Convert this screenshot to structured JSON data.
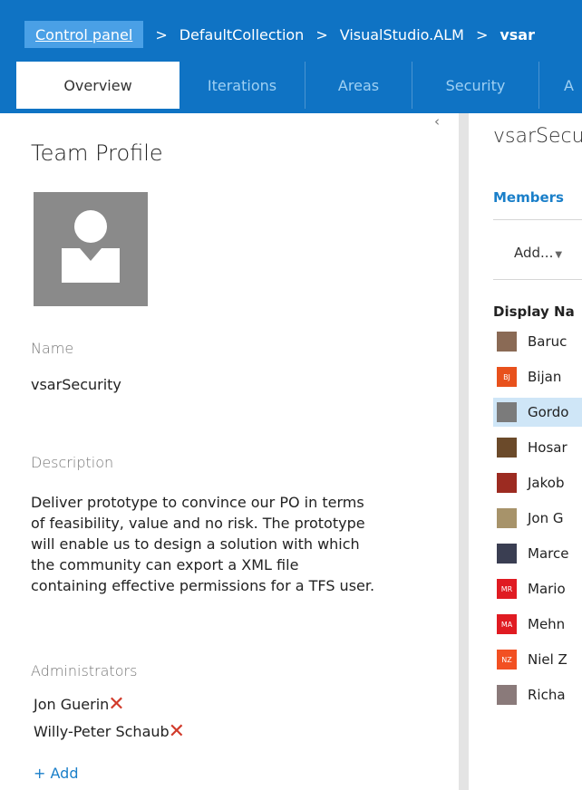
{
  "breadcrumb": {
    "home": "Control panel",
    "separator": ">",
    "collection": "DefaultCollection",
    "project": "VisualStudio.ALM",
    "current": "vsar"
  },
  "tabs": [
    {
      "label": "Overview",
      "active": true
    },
    {
      "label": "Iterations",
      "active": false
    },
    {
      "label": "Areas",
      "active": false
    },
    {
      "label": "Security",
      "active": false
    },
    {
      "label": "A",
      "active": false
    }
  ],
  "left": {
    "collapse_glyph": "‹",
    "title": "Team Profile",
    "avatar_icon": "default-team-avatar-icon",
    "name_label": "Name",
    "name_value": "vsarSecurity",
    "description_label": "Description",
    "description_value": "Deliver prototype to convince our PO in terms of feasibility, value and no risk. The prototype will enable us to design a solution with which the community can export a XML file containing effective permissions for a TFS user.",
    "administrators_label": "Administrators",
    "administrators": [
      {
        "name": "Jon Guerin",
        "remove_icon": "✕"
      },
      {
        "name": "Willy-Peter Schaub",
        "remove_icon": "✕"
      }
    ],
    "add_admin": "+ Add"
  },
  "right": {
    "team_name": "vsarSecu",
    "members_tab": "Members",
    "add_menu": "Add...",
    "add_caret": "▼",
    "column_header": "Display Na",
    "members": [
      {
        "name": "Baruc",
        "avatar": "photo",
        "color": "#8a6a55",
        "initials": ""
      },
      {
        "name": "Bijan",
        "avatar": "initials",
        "color": "#e8511c",
        "initials": "BJ"
      },
      {
        "name": "Gordo",
        "avatar": "photo",
        "color": "#7b7b7b",
        "initials": "",
        "selected": true
      },
      {
        "name": "Hosar",
        "avatar": "photo",
        "color": "#6b4a2a",
        "initials": ""
      },
      {
        "name": "Jakob",
        "avatar": "photo",
        "color": "#9c2b21",
        "initials": ""
      },
      {
        "name": "Jon G",
        "avatar": "photo",
        "color": "#a7936a",
        "initials": ""
      },
      {
        "name": "Marce",
        "avatar": "photo",
        "color": "#3a3e52",
        "initials": ""
      },
      {
        "name": "Mario",
        "avatar": "initials",
        "color": "#e01b22",
        "initials": "MR"
      },
      {
        "name": "Mehn",
        "avatar": "initials",
        "color": "#e01b22",
        "initials": "MA"
      },
      {
        "name": "Niel Z",
        "avatar": "initials",
        "color": "#f25022",
        "initials": "NZ"
      },
      {
        "name": "Richa",
        "avatar": "photo",
        "color": "#8a7a7a",
        "initials": ""
      }
    ]
  },
  "colors": {
    "header_blue": "#0f73c4",
    "home_highlight": "#4aa0e6",
    "link_blue": "#1a7fc9",
    "remove_red": "#d13a2a",
    "selected_row": "#cfe6f7"
  }
}
